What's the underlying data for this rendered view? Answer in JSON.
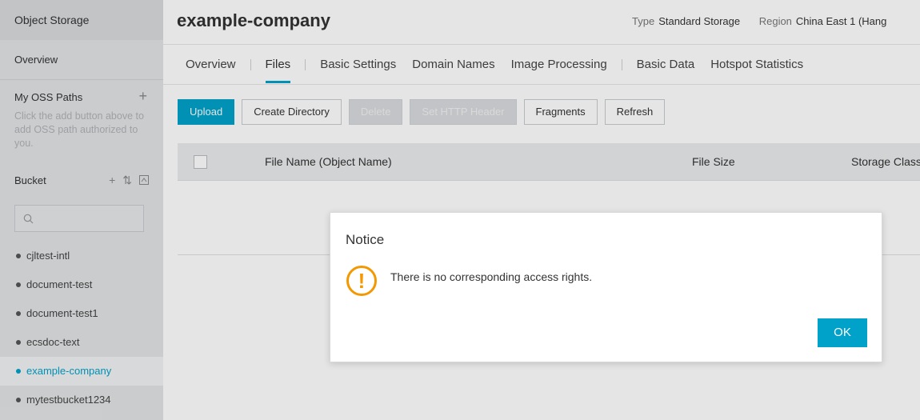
{
  "sidebar": {
    "title": "Object Storage",
    "overview_label": "Overview",
    "oss_paths": {
      "title": "My OSS Paths",
      "add_icon": "+",
      "hint": "Click the add button above to add OSS path authorized to you."
    },
    "bucket": {
      "title": "Bucket",
      "add_icon": "+",
      "sort_icon": "⇅",
      "refresh_icon": "⟳",
      "search_icon": "⚲"
    },
    "buckets": [
      {
        "name": "cjltest-intl"
      },
      {
        "name": "document-test"
      },
      {
        "name": "document-test1"
      },
      {
        "name": "ecsdoc-text"
      },
      {
        "name": "example-company",
        "active": true
      },
      {
        "name": "mytestbucket1234"
      }
    ]
  },
  "header": {
    "title": "example-company",
    "type_label": "Type",
    "type_value": "Standard Storage",
    "region_label": "Region",
    "region_value": "China East 1 (Hang"
  },
  "tabs": [
    {
      "label": "Overview"
    },
    {
      "label": "Files",
      "active": true
    },
    {
      "label": "Basic Settings"
    },
    {
      "label": "Domain Names"
    },
    {
      "label": "Image Processing"
    },
    {
      "label": "Basic Data"
    },
    {
      "label": "Hotspot Statistics"
    }
  ],
  "toolbar": {
    "upload": "Upload",
    "create_directory": "Create Directory",
    "delete": "Delete",
    "set_http_header": "Set HTTP Header",
    "fragments": "Fragments",
    "refresh": "Refresh"
  },
  "table": {
    "columns": {
      "name": "File Name (Object Name)",
      "size": "File Size",
      "storage_class": "Storage Class"
    }
  },
  "modal": {
    "title": "Notice",
    "icon": "!",
    "message": "There is no corresponding access rights.",
    "ok_label": "OK"
  },
  "colors": {
    "accent": "#00a2ca",
    "warning": "#f39800",
    "sidebar_bg": "#e2e4e6"
  }
}
